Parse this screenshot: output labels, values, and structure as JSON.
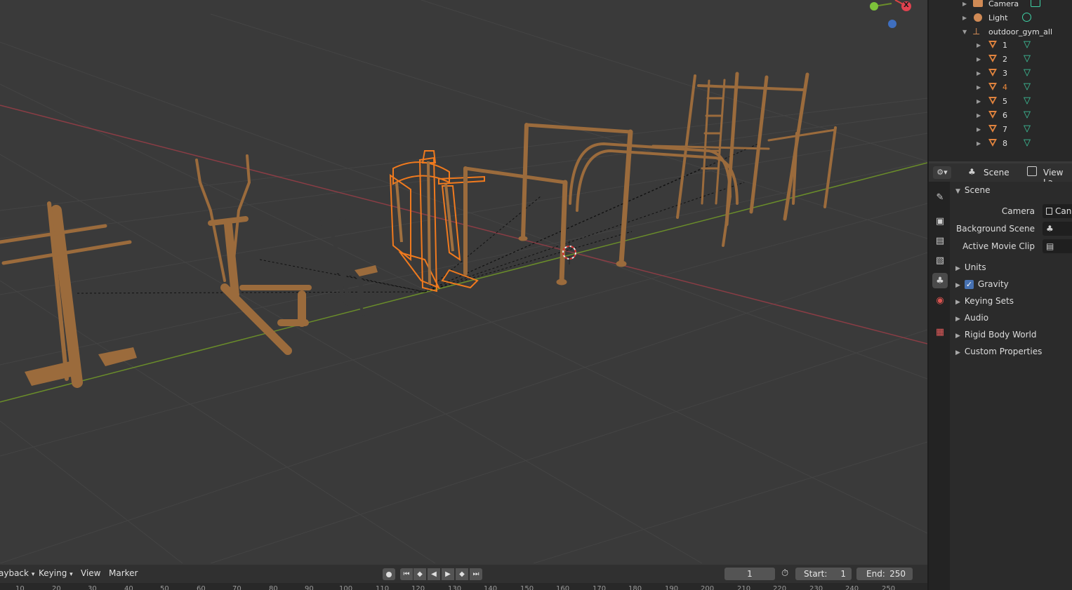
{
  "outliner": {
    "items": [
      {
        "label": "Camera",
        "icon": "camera-icon",
        "data_icon": "camera-data-icon"
      },
      {
        "label": "Light",
        "icon": "light-icon",
        "data_icon": "light-data-icon"
      },
      {
        "label": "outdoor_gym_all",
        "icon": "empty-icon"
      },
      {
        "label": "1",
        "icon": "mesh-object-icon",
        "data_icon": "mesh-data-icon"
      },
      {
        "label": "2",
        "icon": "mesh-object-icon",
        "data_icon": "mesh-data-icon"
      },
      {
        "label": "3",
        "icon": "mesh-object-icon",
        "data_icon": "mesh-data-icon"
      },
      {
        "label": "4",
        "icon": "mesh-object-icon",
        "data_icon": "mesh-data-icon",
        "selected": true
      },
      {
        "label": "5",
        "icon": "mesh-object-icon",
        "data_icon": "mesh-data-icon"
      },
      {
        "label": "6",
        "icon": "mesh-object-icon",
        "data_icon": "mesh-data-icon"
      },
      {
        "label": "7",
        "icon": "mesh-object-icon",
        "data_icon": "mesh-data-icon"
      },
      {
        "label": "8",
        "icon": "mesh-object-icon",
        "data_icon": "mesh-data-icon"
      }
    ]
  },
  "properties": {
    "header": {
      "scene_label": "Scene",
      "view_layer_label": "View La"
    },
    "panel_title": "Scene",
    "fields": {
      "camera_label": "Camera",
      "camera_value": "Can",
      "background_scene_label": "Background Scene",
      "active_movie_clip_label": "Active Movie Clip"
    },
    "subpanels": [
      "Units",
      "Gravity",
      "Keying Sets",
      "Audio",
      "Rigid Body World",
      "Custom Properties"
    ],
    "gravity_checked": true
  },
  "timeline": {
    "menus": {
      "playback": "ayback",
      "keying": "Keying",
      "view": "View",
      "marker": "Marker"
    },
    "current_frame": "1",
    "start_label": "Start:",
    "start_value": "1",
    "end_label": "End:",
    "end_value": "250",
    "ruler": [
      "10",
      "20",
      "30",
      "40",
      "50",
      "60",
      "70",
      "80",
      "90",
      "100",
      "110",
      "120",
      "130",
      "140",
      "150",
      "160",
      "170",
      "180",
      "190",
      "200",
      "210",
      "220",
      "230",
      "240",
      "250"
    ]
  },
  "viewport": {
    "gizmo_axis_label": "X",
    "colors": {
      "equipment": "#a0703f",
      "selected_outline": "#f07a1e",
      "x_axis": "#9c3b44",
      "y_axis": "#6b8e23",
      "grid": "#454545"
    }
  }
}
